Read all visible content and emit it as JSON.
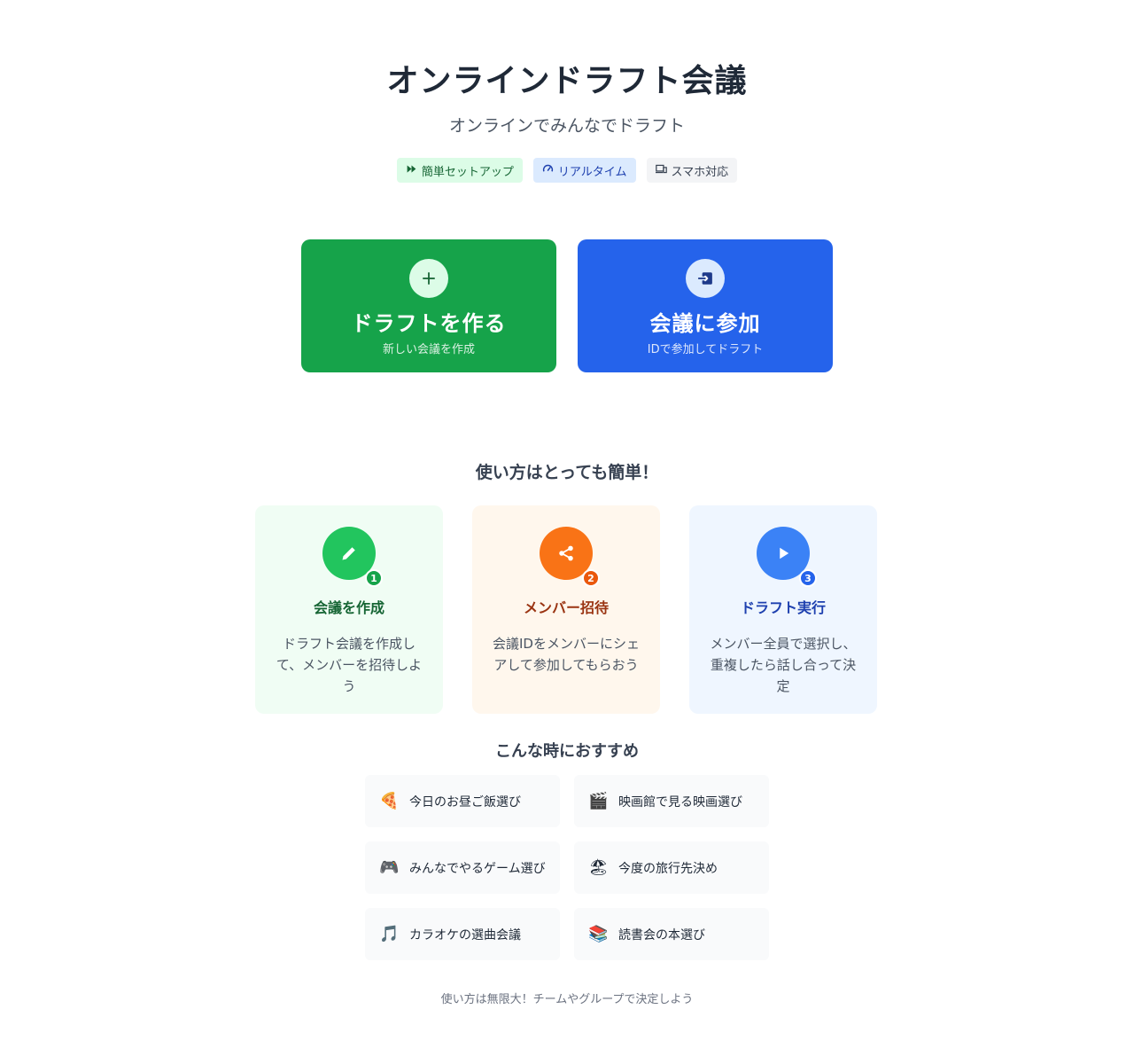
{
  "hero": {
    "title": "オンラインドラフト会議",
    "subtitle": "オンラインでみんなでドラフト"
  },
  "badges": [
    {
      "label": "簡単セットアップ",
      "icon": "fast-forward-icon"
    },
    {
      "label": "リアルタイム",
      "icon": "speedometer-icon"
    },
    {
      "label": "スマホ対応",
      "icon": "devices-icon"
    }
  ],
  "actions": {
    "create": {
      "title": "ドラフトを作る",
      "subtitle": "新しい会議を作成",
      "icon": "plus-icon",
      "color": "#16a34a"
    },
    "join": {
      "title": "会議に参加",
      "subtitle": "IDで参加してドラフト",
      "icon": "login-icon",
      "color": "#2563eb"
    }
  },
  "howto": {
    "title": "使い方はとっても簡単！",
    "steps": [
      {
        "number": "1",
        "title": "会議を作成",
        "description": "ドラフト会議を作成して、メンバーを招待しよう",
        "icon": "pencil-icon",
        "color": "#22c55e"
      },
      {
        "number": "2",
        "title": "メンバー招待",
        "description": "会議IDをメンバーにシェアして参加してもらおう",
        "icon": "share-icon",
        "color": "#f97316"
      },
      {
        "number": "3",
        "title": "ドラフト実行",
        "description": "メンバー全員で選択し、重複したら話し合って決定",
        "icon": "play-icon",
        "color": "#3b82f6"
      }
    ]
  },
  "recommend": {
    "title": "こんな時におすすめ",
    "items": [
      {
        "emoji": "🍕",
        "label": "今日のお昼ご飯選び"
      },
      {
        "emoji": "🎬",
        "label": "映画館で見る映画選び"
      },
      {
        "emoji": "🎮",
        "label": "みんなでやるゲーム選び"
      },
      {
        "emoji": "🏖",
        "label": "今度の旅行先決め"
      },
      {
        "emoji": "🎵",
        "label": "カラオケの選曲会議"
      },
      {
        "emoji": "📚",
        "label": "読書会の本選び"
      }
    ]
  },
  "footer": {
    "note": "使い方は無限大！チームやグループで決定しよう"
  }
}
